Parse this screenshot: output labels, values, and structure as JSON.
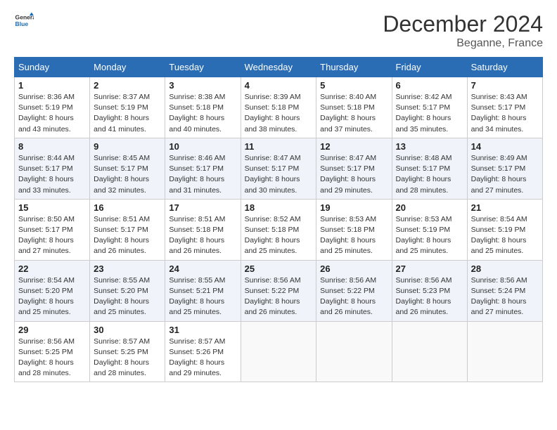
{
  "header": {
    "logo_line1": "General",
    "logo_line2": "Blue",
    "title": "December 2024",
    "subtitle": "Beganne, France"
  },
  "columns": [
    "Sunday",
    "Monday",
    "Tuesday",
    "Wednesday",
    "Thursday",
    "Friday",
    "Saturday"
  ],
  "weeks": [
    [
      {
        "day": "1",
        "detail": "Sunrise: 8:36 AM\nSunset: 5:19 PM\nDaylight: 8 hours\nand 43 minutes."
      },
      {
        "day": "2",
        "detail": "Sunrise: 8:37 AM\nSunset: 5:19 PM\nDaylight: 8 hours\nand 41 minutes."
      },
      {
        "day": "3",
        "detail": "Sunrise: 8:38 AM\nSunset: 5:18 PM\nDaylight: 8 hours\nand 40 minutes."
      },
      {
        "day": "4",
        "detail": "Sunrise: 8:39 AM\nSunset: 5:18 PM\nDaylight: 8 hours\nand 38 minutes."
      },
      {
        "day": "5",
        "detail": "Sunrise: 8:40 AM\nSunset: 5:18 PM\nDaylight: 8 hours\nand 37 minutes."
      },
      {
        "day": "6",
        "detail": "Sunrise: 8:42 AM\nSunset: 5:17 PM\nDaylight: 8 hours\nand 35 minutes."
      },
      {
        "day": "7",
        "detail": "Sunrise: 8:43 AM\nSunset: 5:17 PM\nDaylight: 8 hours\nand 34 minutes."
      }
    ],
    [
      {
        "day": "8",
        "detail": "Sunrise: 8:44 AM\nSunset: 5:17 PM\nDaylight: 8 hours\nand 33 minutes."
      },
      {
        "day": "9",
        "detail": "Sunrise: 8:45 AM\nSunset: 5:17 PM\nDaylight: 8 hours\nand 32 minutes."
      },
      {
        "day": "10",
        "detail": "Sunrise: 8:46 AM\nSunset: 5:17 PM\nDaylight: 8 hours\nand 31 minutes."
      },
      {
        "day": "11",
        "detail": "Sunrise: 8:47 AM\nSunset: 5:17 PM\nDaylight: 8 hours\nand 30 minutes."
      },
      {
        "day": "12",
        "detail": "Sunrise: 8:47 AM\nSunset: 5:17 PM\nDaylight: 8 hours\nand 29 minutes."
      },
      {
        "day": "13",
        "detail": "Sunrise: 8:48 AM\nSunset: 5:17 PM\nDaylight: 8 hours\nand 28 minutes."
      },
      {
        "day": "14",
        "detail": "Sunrise: 8:49 AM\nSunset: 5:17 PM\nDaylight: 8 hours\nand 27 minutes."
      }
    ],
    [
      {
        "day": "15",
        "detail": "Sunrise: 8:50 AM\nSunset: 5:17 PM\nDaylight: 8 hours\nand 27 minutes."
      },
      {
        "day": "16",
        "detail": "Sunrise: 8:51 AM\nSunset: 5:17 PM\nDaylight: 8 hours\nand 26 minutes."
      },
      {
        "day": "17",
        "detail": "Sunrise: 8:51 AM\nSunset: 5:18 PM\nDaylight: 8 hours\nand 26 minutes."
      },
      {
        "day": "18",
        "detail": "Sunrise: 8:52 AM\nSunset: 5:18 PM\nDaylight: 8 hours\nand 25 minutes."
      },
      {
        "day": "19",
        "detail": "Sunrise: 8:53 AM\nSunset: 5:18 PM\nDaylight: 8 hours\nand 25 minutes."
      },
      {
        "day": "20",
        "detail": "Sunrise: 8:53 AM\nSunset: 5:19 PM\nDaylight: 8 hours\nand 25 minutes."
      },
      {
        "day": "21",
        "detail": "Sunrise: 8:54 AM\nSunset: 5:19 PM\nDaylight: 8 hours\nand 25 minutes."
      }
    ],
    [
      {
        "day": "22",
        "detail": "Sunrise: 8:54 AM\nSunset: 5:20 PM\nDaylight: 8 hours\nand 25 minutes."
      },
      {
        "day": "23",
        "detail": "Sunrise: 8:55 AM\nSunset: 5:20 PM\nDaylight: 8 hours\nand 25 minutes."
      },
      {
        "day": "24",
        "detail": "Sunrise: 8:55 AM\nSunset: 5:21 PM\nDaylight: 8 hours\nand 25 minutes."
      },
      {
        "day": "25",
        "detail": "Sunrise: 8:56 AM\nSunset: 5:22 PM\nDaylight: 8 hours\nand 26 minutes."
      },
      {
        "day": "26",
        "detail": "Sunrise: 8:56 AM\nSunset: 5:22 PM\nDaylight: 8 hours\nand 26 minutes."
      },
      {
        "day": "27",
        "detail": "Sunrise: 8:56 AM\nSunset: 5:23 PM\nDaylight: 8 hours\nand 26 minutes."
      },
      {
        "day": "28",
        "detail": "Sunrise: 8:56 AM\nSunset: 5:24 PM\nDaylight: 8 hours\nand 27 minutes."
      }
    ],
    [
      {
        "day": "29",
        "detail": "Sunrise: 8:56 AM\nSunset: 5:25 PM\nDaylight: 8 hours\nand 28 minutes."
      },
      {
        "day": "30",
        "detail": "Sunrise: 8:57 AM\nSunset: 5:25 PM\nDaylight: 8 hours\nand 28 minutes."
      },
      {
        "day": "31",
        "detail": "Sunrise: 8:57 AM\nSunset: 5:26 PM\nDaylight: 8 hours\nand 29 minutes."
      },
      null,
      null,
      null,
      null
    ]
  ]
}
